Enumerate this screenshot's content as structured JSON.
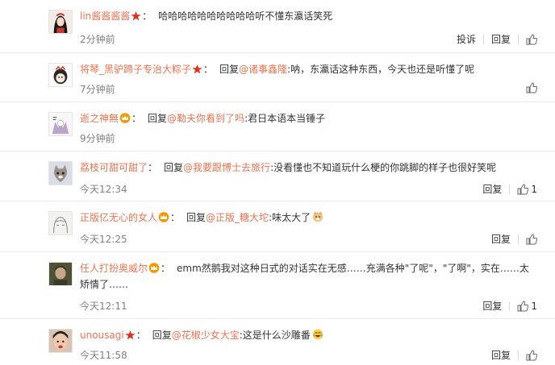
{
  "comments": [
    {
      "user": "lin酱酱酱酱",
      "badge": "star",
      "reply_word": "",
      "mention": "",
      "text": "哈哈哈哈哈哈哈哈哈哈听不懂东瀛话笑死",
      "time": "2分钟前",
      "report": "投诉",
      "reply": "回复",
      "likes": ""
    },
    {
      "user": "将琴_黑驴蹄子专治大粽子",
      "badge": "star",
      "reply_word": "回复",
      "mention": "@诸事鑫隆",
      "text": ":呐，东瀛话这种东西，今天也还是听懂了呢",
      "time": "7分钟前",
      "report": "",
      "reply": "回复",
      "likes": ""
    },
    {
      "user": "逝之神無",
      "badge": "crown",
      "reply_word": "回复",
      "mention": "@勒夫你看到了吗",
      "text": ":君日本语本当锤子",
      "time": "9分钟前",
      "report": "",
      "reply": "",
      "likes": ""
    },
    {
      "user": "荔枝可甜可甜了",
      "badge": "",
      "reply_word": "回复",
      "mention": "@我要跟博士去旅行",
      "text": ":没看懂也不知道玩什么梗的你跳脚的样子也很好笑呢",
      "time": "今天12:34",
      "report": "",
      "reply": "回复",
      "likes": "1"
    },
    {
      "user": "正版亿无心的女人",
      "badge": "crown",
      "reply_word": "回复",
      "mention": "@正版_糖大坨",
      "text": ":味太大了",
      "emoji": "doge",
      "time": "今天12:25",
      "report": "",
      "reply": "回复",
      "likes": ""
    },
    {
      "user": "任人打扮奥威尔",
      "badge": "crown",
      "reply_word": "",
      "mention": "",
      "text": "emm然鹅我对这种日式的对话实在无感……充满各种\"了呢\"，\"了啊\"，实在……太矫情了……",
      "time": "今天12:11",
      "report": "",
      "reply": "回复",
      "likes": "1"
    },
    {
      "user": "unousagi",
      "badge": "star",
      "reply_word": "回复",
      "mention": "@花椒少女大宝",
      "text": ":这是什么沙雕番",
      "emoji": "laugh",
      "time": "今天11:58",
      "report": "",
      "reply": "回复",
      "likes": ""
    }
  ],
  "colors": {
    "link": "#eb7350",
    "text": "#333333",
    "time": "#808080",
    "star": "#e0301e",
    "crown": "#f39800"
  }
}
